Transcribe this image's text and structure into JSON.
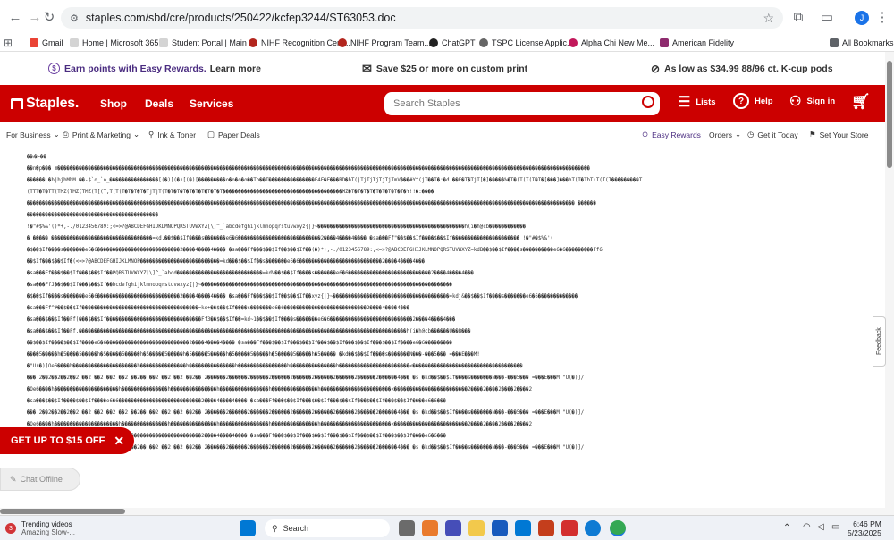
{
  "browser": {
    "url": "staples.com/sbd/cre/products/250422/kcfep3244/ST63053.doc",
    "profile_initial": "J",
    "bookmarks": [
      "Gmail",
      "Home | Microsoft 365",
      "Student Portal | Main",
      "NIHF Recognition Cent...",
      "NIHF Program Team...",
      "ChatGPT",
      "TSPC License Applic...",
      "Alpha Chi New Me...",
      "American Fidelity"
    ],
    "all_bookmarks": "All Bookmarks"
  },
  "promo": {
    "rewards_bold": "Earn points with Easy Rewards.",
    "rewards_link": "Learn more",
    "print": "Save $25 or more on custom print",
    "kcup": "As low as $34.99 88/96 ct. K-cup pods"
  },
  "header": {
    "logo": "Staples.",
    "nav": [
      "Shop",
      "Deals",
      "Services"
    ],
    "search_placeholder": "Search Staples",
    "lists": "Lists",
    "help": "Help",
    "signin": "Sign in"
  },
  "subnav": {
    "business": "For Business",
    "print": "Print & Marketing",
    "ink": "Ink & Toner",
    "paper": "Paper Deals",
    "rewards": "Easy Rewards",
    "orders": "Orders",
    "today": "Get it Today",
    "store": "Set Your Store"
  },
  "doc_lines": [
    "��ࡱ�>��",
    "��n�p��� m������������������������������������������������������������������������������������������������������������������������������������������������������������������������������",
    "������ �bjbjbMbM ��-$`o_`o_����������������[(�)[(�)[(�)[���������o�o�o�o��To��T���������������E4F�F���RD�hT(jTjTjTjTjTjTmV���#Y^(jT��T�:�d ��E�T�TjT[�]�����%�T�(T(T(T�T�[���]���hT(T�ThT(T(T(T���������T",
    "(TTT�T�TT(TMZ(TMZ(TMZ(T[(T,T(T(T�T�T�T�TjTjT(T�T�T�T�T�T�T�T�T�T���������������������������������������MZ�T�T�T�T�T�T�T�T�T�Y!!�:����",
    "����������������������������������������������������������������������������������������������������������������������������������������������������������������������������������� ������",
    "�������������������������������������������",
    "!�\"#$%&'()*+,-./0123456789:;<=>?@ABCDEFGHIJKLMNOPQRSTUVWXYZ[\\]^_`abcdefghijklmnopqrstuvwxyz{|}~������������������������������������������������h(i�h@cb������������",
    "� ����� ���������������������������������=kd.��$��$If����s�������e6�6���������������������������2����4����4���� �sa���Ff\"��$��$If����$��$If���������������������� !�\"#�$%&'(",
    "�$��$If����s�������e6�6���������������������������2����4����4���� �sa���Ff���$��$If��$��$If��(�)*+,-./0123456789:;<=>?@ABCDEFGHIJKLMNOPQRSTUVWXYZ=kdB��$��$If����s����������e6�6���������Ff6",
    "��$If���$��$If�(<=>?@ABCDEFGHIJKLMNOP��������������������������=kd���$��$If��s�������e6�6���������������������������2����4����4���",
    "�sa���Ff���$��$If���$��$If��PQRSTUVWXYZ[\\]^_`abcd����������������������������=kdV��$��$If����s�������e6�6���������������������������2����4����4���",
    "�sa���FfJ��$��$If���$��$If��bcdefghijklmnopqrstuvwxyz{|}~����������������������������������������������������������������������������������",
    "�$��$If����s�������e6�6���������������������������2����4����4���� �sa���Ff���$��$If��$��$If��xyz{|}~��������������������������������������=kdj&��$��$If����s�������e6�6�������������",
    "�sa���Ff^#��$��$If��������������������������������������=kd+��$��$If����s�������e6�6���������������������������2����4����4���",
    "�sa���$��$If��Ff(���$��$If�������������������������������Ff3��$��$If��=kd~1��$��$If����s�������e6�6���������������������������2����4����4���",
    "�sa���$��$If��Ff.�����������������������������������������������������������������������������������������������������������h(i�h@cb������U��B���",
    "��$��$If����$��$If����e6�6���������������������������2����4����4���� �sa���Ff���$��$If���$��$If���$��$If���$��$If���$��$If����e6�6���������",
    "����5�����h�5����5�����h�5�����5�����h�5�����5�����h�5�����5�����h�5�����5�����h�5�����5�����h�5����� �kd��$��$If����s�������N���-���5��� =���E���M!",
    "�\"U(�)]Oe6����h���������������������h���������������h���������������h����������������h���������������h�����������������������<������������������������������������",
    "��� 2��2��2��2��2 ��2 ��2 ��2 ��2 ��2�� ��2 ��2 ��2 ��2�� 2������2������2������2������2������2������2������2������2������4��� �s �kd��$��$If����s�������N���-���5��� =���E���M!\"U(�)]/",
    "�Oe6����h���������������������h���������������h���������������h����������������h���������������h�����������������������<������������������������2����2����2����2����2",
    "�sa���$��$If����$��$If����e6�6���������������������������2����4����4���� �sa���Ff���$��$If���$��$If���$��$If���$��$If���$��$If����e6�6���",
    "��� 2��2��2��2��2 ��2 ��2 ��2 ��2 ��2�� ��2 ��2 ��2 ��2�� 2������2������2������2������2������2������2������2������2������4��� �s �kd��$��$If����s�������N���-���5��� =���E���M!\"U(�)]/",
    "�Oe6����h���������������������h���������������h���������������h����������������h���������������h�����������������������<������������������������2����2����2����2����2",
    "�sa���$��$If����$��$If����e6�6���������������������������2����4����4���� �sa���Ff���$��$If���$��$If���$��$If���$��$If���$��$If����e6�6���",
    "��� 2��2��2��2��2 ��2 ��2 ��2 ��2 ��2�� ��2 ��2 ��2 ��2�� 2������2������2������2������2������2������2������2������2������4��� �s �kd��$��$If����s�������N���-���5��� =���E���M!\"U(�)]/"
  ],
  "offer": "GET UP TO $15 OFF",
  "chat": "Chat Offline",
  "feedback": "Feedback",
  "taskbar": {
    "news_badge": "3",
    "news_title": "Trending videos",
    "news_sub": "Amazing Slow-...",
    "search": "Search",
    "time": "6:46 PM",
    "date": "5/23/2025"
  }
}
